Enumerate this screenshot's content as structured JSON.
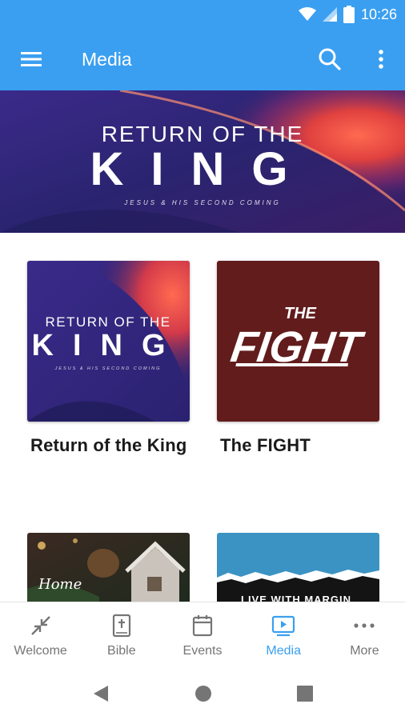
{
  "status_bar": {
    "time": "10:26"
  },
  "app_bar": {
    "title": "Media"
  },
  "hero": {
    "line1": "RETURN OF THE",
    "line2": "KING",
    "tagline": "JESUS & HIS SECOND COMING"
  },
  "cards": [
    {
      "title": "Return of the King",
      "art_line1": "RETURN OF THE",
      "art_line2": "KING",
      "art_tagline": "JESUS & HIS SECOND COMING"
    },
    {
      "title": "The FIGHT",
      "art_line1": "THE",
      "art_line2": "FIGHT"
    },
    {
      "art_text": "Home"
    },
    {
      "art_text": "LIVE WITH MARGIN"
    }
  ],
  "bottom_nav": {
    "items": [
      {
        "label": "Welcome",
        "icon": "collapse-arrows-icon"
      },
      {
        "label": "Bible",
        "icon": "bible-icon"
      },
      {
        "label": "Events",
        "icon": "calendar-icon"
      },
      {
        "label": "Media",
        "icon": "media-play-icon",
        "active": true
      },
      {
        "label": "More",
        "icon": "more-horizontal-icon"
      }
    ]
  },
  "colors": {
    "primary": "#3a9ff0",
    "nav_inactive": "#757575",
    "fight_bg": "#6a1f1f"
  }
}
